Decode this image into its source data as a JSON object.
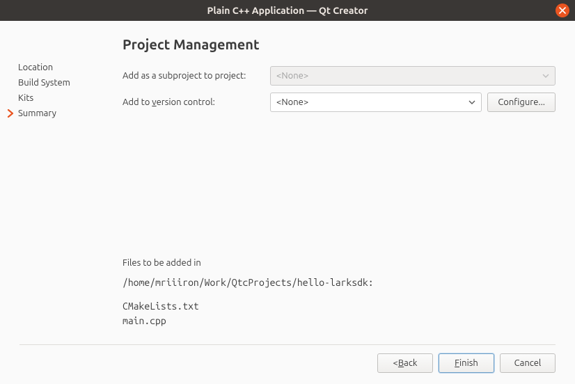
{
  "title": "Plain C++ Application — Qt Creator",
  "sidebar": {
    "items": [
      {
        "label": "Location"
      },
      {
        "label": "Build System"
      },
      {
        "label": "Kits"
      },
      {
        "label": "Summary"
      }
    ]
  },
  "page_heading": "Project Management",
  "form": {
    "subproject_label": "Add as a subproject to project:",
    "subproject_value": "<None>",
    "vcs_label_pre": "Add to ",
    "vcs_label_u": "v",
    "vcs_label_post": "ersion control:",
    "vcs_value": "<None>",
    "configure_label": "Configure..."
  },
  "files": {
    "heading": "Files to be added in",
    "path": "/home/mriiiron/Work/QtcProjects/hello-larksdk:",
    "items": [
      "CMakeLists.txt",
      "main.cpp"
    ]
  },
  "buttons": {
    "back_pre": "< ",
    "back_u": "B",
    "back_post": "ack",
    "finish_u": "F",
    "finish_post": "inish",
    "cancel": "Cancel"
  }
}
